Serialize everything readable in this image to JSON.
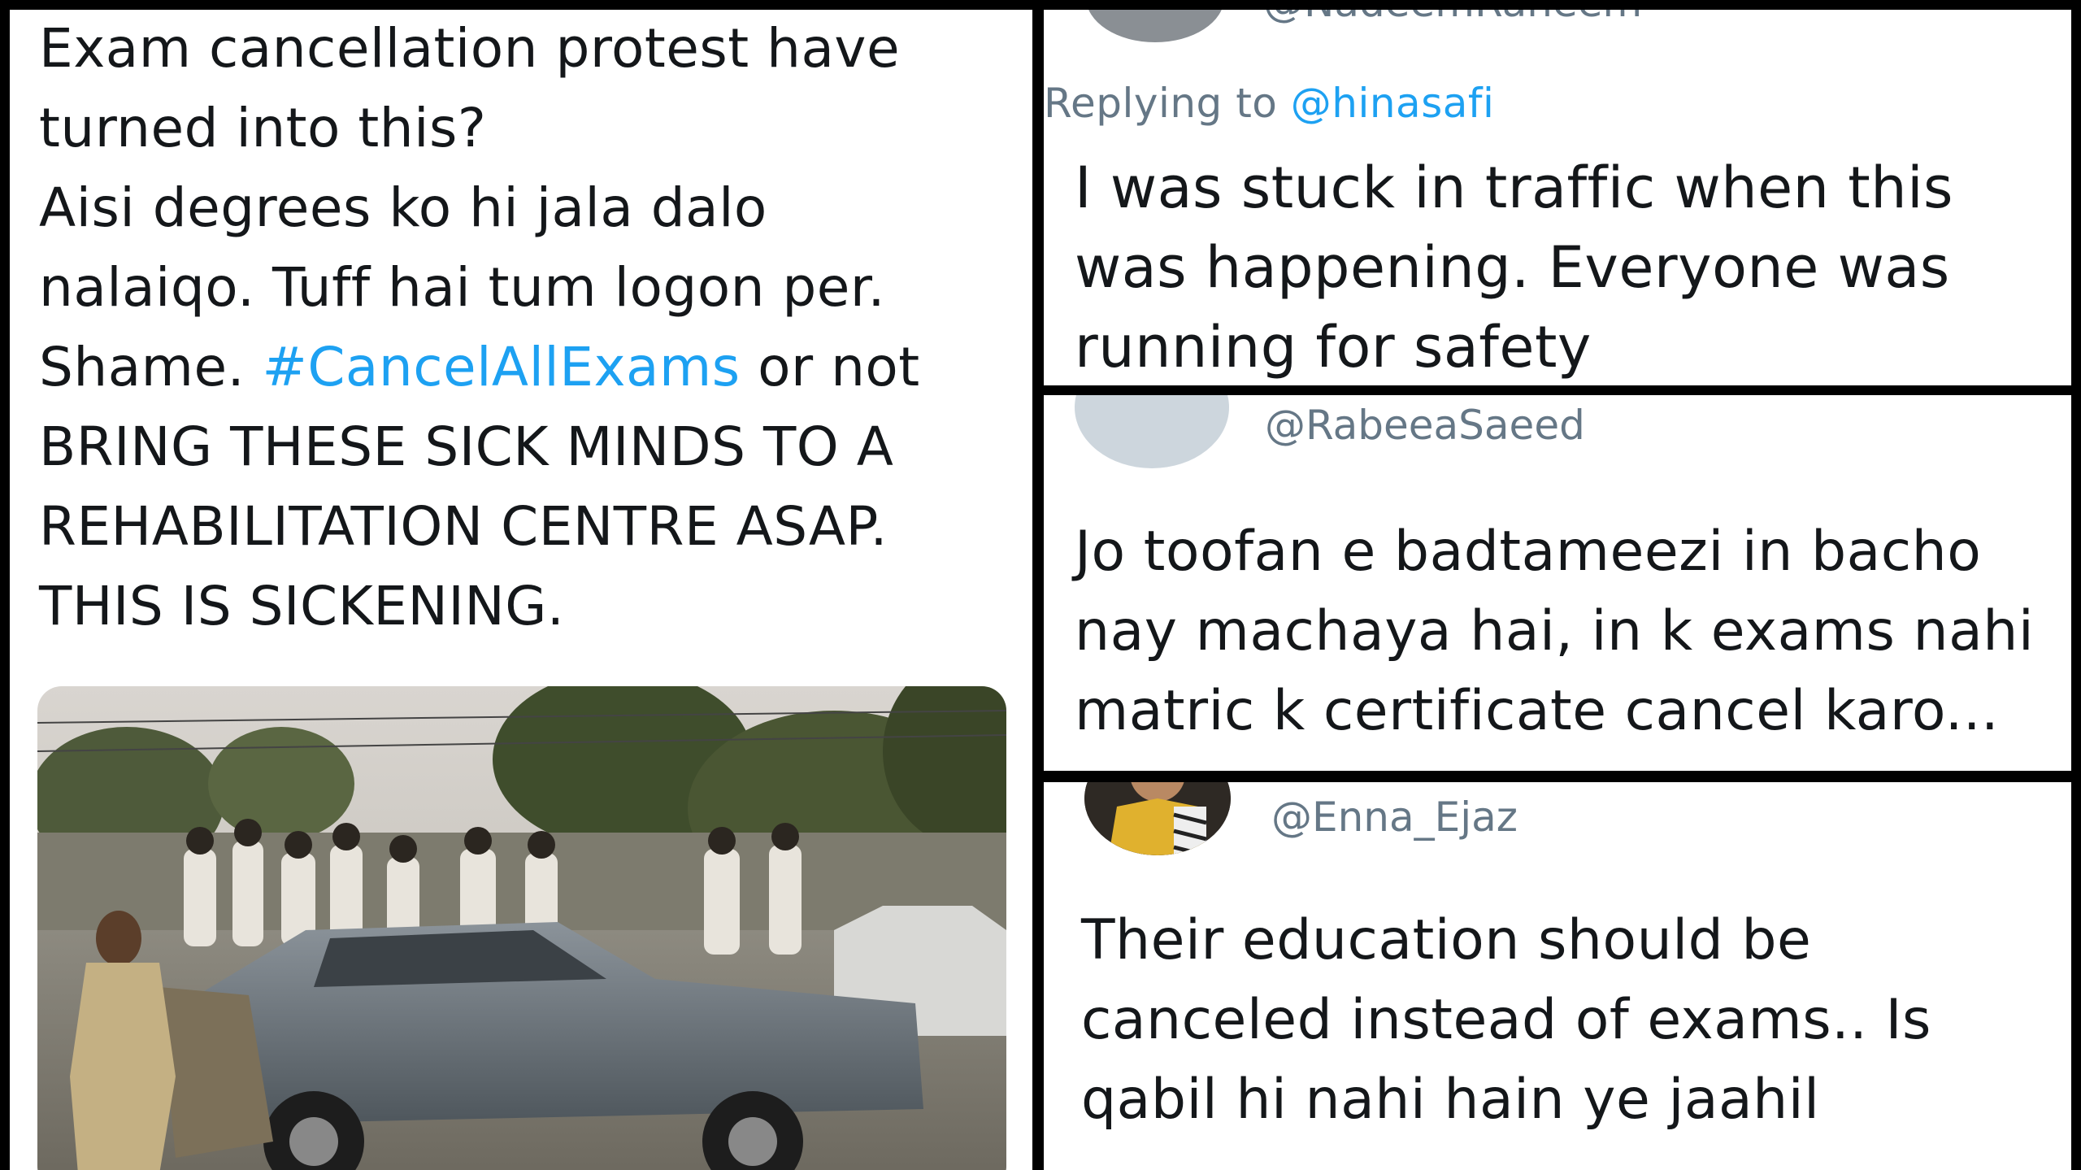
{
  "colors": {
    "link": "#1da1f2",
    "text": "#14171a",
    "muted": "#657786",
    "divider": "#000000"
  },
  "main_tweet": {
    "line_1": "Exam cancellation protest have",
    "line_2": "turned into this?",
    "line_3": "Aisi degrees ko hi jala dalo",
    "line_4": "nalaiqo. Tuff hai tum logon per.",
    "line_5_pre": "Shame. ",
    "hashtag": "#CancelAllExams",
    "line_5_post": " or not",
    "line_6": "BRING THESE SICK MINDS TO A",
    "line_7": "REHABILITATION CENTRE ASAP.",
    "line_8": "THIS IS SICKENING."
  },
  "reply_1": {
    "handle_partial": "@NadeemRaheem",
    "replying_prefix": "Replying to ",
    "replying_to": "@hinasafi",
    "line_1": "I was stuck in traffic when this",
    "line_2": "was happening. Everyone was",
    "line_3": "running for safety"
  },
  "reply_2": {
    "handle": "@RabeeaSaeed",
    "line_1": "Jo toofan e badtameezi in bacho",
    "line_2": "nay machaya hai, in k exams nahi",
    "line_3": "matric k certificate cancel karo..."
  },
  "reply_3": {
    "handle": "@Enna_Ejaz",
    "line_1": "Their education should be",
    "line_2": "canceled instead of exams.. Is",
    "line_3": "qabil hi nahi hain ye jaahil"
  }
}
